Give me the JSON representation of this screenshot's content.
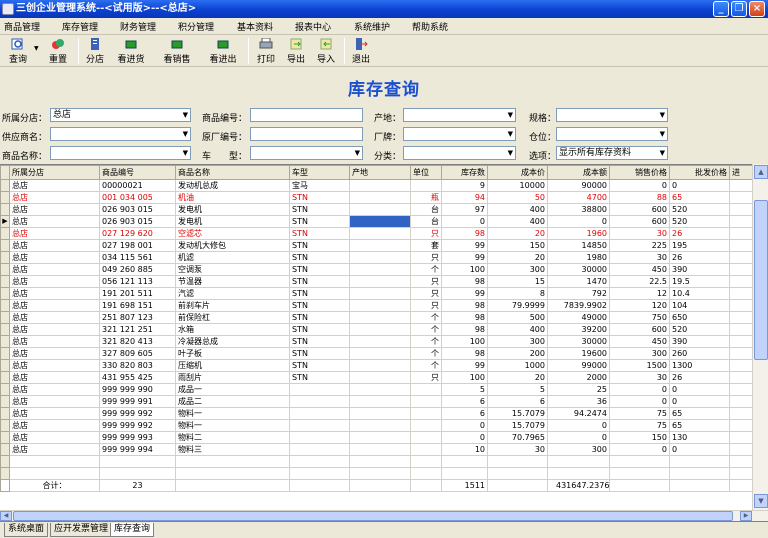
{
  "window": {
    "title": "三创企业管理系统--<试用版>--<总店>"
  },
  "menu": [
    "商品管理",
    "库存管理",
    "财务管理",
    "积分管理",
    "基本资料",
    "报表中心",
    "系统维护",
    "帮助系统"
  ],
  "toolbar": [
    {
      "label": "查询",
      "icon": "query-icon"
    },
    {
      "label": "重置",
      "icon": "reset-icon"
    },
    {
      "label": "分店",
      "icon": "branch-icon"
    },
    {
      "label": "看进货",
      "icon": "purchase-icon"
    },
    {
      "label": "看销售",
      "icon": "sales-icon"
    },
    {
      "label": "看进出",
      "icon": "inout-icon"
    },
    {
      "label": "打印",
      "icon": "print-icon"
    },
    {
      "label": "导出",
      "icon": "export-icon"
    },
    {
      "label": "导入",
      "icon": "import-icon"
    },
    {
      "label": "退出",
      "icon": "exit-icon"
    }
  ],
  "heading": "库存查询",
  "filters": {
    "branch_label": "所属分店：",
    "branch_value": "总店",
    "code_label": "商品编号：",
    "code_value": "",
    "origin_label": "产地：",
    "origin_value": "",
    "spec_label": "规格：",
    "spec_value": "",
    "supplier_label": "供应商名：",
    "supplier_value": "",
    "factory_code_label": "原厂编号：",
    "factory_code_value": "",
    "brand_label": "厂牌：",
    "brand_value": "",
    "location_label": "仓位：",
    "location_value": "",
    "name_label": "商品名称：",
    "name_value": "",
    "car_label": "车　　型：",
    "car_value": "",
    "category_label": "分类：",
    "category_value": "",
    "option_label": "选项：",
    "option_value": "显示所有库存资料"
  },
  "colors": {
    "title_blue": "#0a3fcf",
    "heading": "#1c50d0",
    "red_row": "#e00000",
    "selected": "#3163c5"
  },
  "table": {
    "columns": [
      "所属分店",
      "商品编号",
      "商品名称",
      "车型",
      "产地",
      "单位",
      "库存数",
      "成本价",
      "成本额",
      "销售价格",
      "批发价格",
      "进"
    ],
    "rows": [
      {
        "c": [
          "总店",
          "00000021",
          "发动机总成",
          "宝马",
          "",
          "",
          "9",
          "10000",
          "90000",
          "0",
          "0"
        ],
        "red": false
      },
      {
        "c": [
          "总店",
          "001 034 005",
          "机油",
          "STN",
          "",
          "瓶",
          "94",
          "50",
          "4700",
          "88",
          "65"
        ],
        "red": true
      },
      {
        "c": [
          "总店",
          "026 903 015",
          "发电机",
          "STN",
          "",
          "台",
          "97",
          "400",
          "38800",
          "600",
          "520"
        ],
        "red": false
      },
      {
        "c": [
          "总店",
          "026 903 015",
          "发电机",
          "STN",
          "",
          "台",
          "0",
          "400",
          "0",
          "600",
          "520"
        ],
        "red": false,
        "selected": true
      },
      {
        "c": [
          "总店",
          "027 129 620",
          "空滤芯",
          "STN",
          "",
          "只",
          "98",
          "20",
          "1960",
          "30",
          "26"
        ],
        "red": true
      },
      {
        "c": [
          "总店",
          "027 198 001",
          "发动机大修包",
          "STN",
          "",
          "套",
          "99",
          "150",
          "14850",
          "225",
          "195"
        ],
        "red": false
      },
      {
        "c": [
          "总店",
          "034 115 561",
          "机滤",
          "STN",
          "",
          "只",
          "99",
          "20",
          "1980",
          "30",
          "26"
        ],
        "red": false
      },
      {
        "c": [
          "总店",
          "049 260 885",
          "空调泵",
          "STN",
          "",
          "个",
          "100",
          "300",
          "30000",
          "450",
          "390"
        ],
        "red": false
      },
      {
        "c": [
          "总店",
          "056 121 113",
          "节温器",
          "STN",
          "",
          "只",
          "98",
          "15",
          "1470",
          "22.5",
          "19.5"
        ],
        "red": false
      },
      {
        "c": [
          "总店",
          "191 201 511",
          "汽滤",
          "STN",
          "",
          "只",
          "99",
          "8",
          "792",
          "12",
          "10.4"
        ],
        "red": false
      },
      {
        "c": [
          "总店",
          "191 698 151",
          "前刹车片",
          "STN",
          "",
          "只",
          "98",
          "79.9999",
          "7839.9902",
          "120",
          "104"
        ],
        "red": false
      },
      {
        "c": [
          "总店",
          "251 807 123",
          "前保险杠",
          "STN",
          "",
          "个",
          "98",
          "500",
          "49000",
          "750",
          "650"
        ],
        "red": false
      },
      {
        "c": [
          "总店",
          "321 121 251",
          "水箱",
          "STN",
          "",
          "个",
          "98",
          "400",
          "39200",
          "600",
          "520"
        ],
        "red": false
      },
      {
        "c": [
          "总店",
          "321 820 413",
          "冷凝器总成",
          "STN",
          "",
          "个",
          "100",
          "300",
          "30000",
          "450",
          "390"
        ],
        "red": false
      },
      {
        "c": [
          "总店",
          "327 809 605",
          "叶子板",
          "STN",
          "",
          "个",
          "98",
          "200",
          "19600",
          "300",
          "260"
        ],
        "red": false
      },
      {
        "c": [
          "总店",
          "330 820 803",
          "压缩机",
          "STN",
          "",
          "个",
          "99",
          "1000",
          "99000",
          "1500",
          "1300"
        ],
        "red": false
      },
      {
        "c": [
          "总店",
          "431 955 425",
          "雨刮片",
          "STN",
          "",
          "只",
          "100",
          "20",
          "2000",
          "30",
          "26"
        ],
        "red": false
      },
      {
        "c": [
          "总店",
          "999 999 990",
          "成品一",
          "",
          "",
          "",
          "5",
          "5",
          "25",
          "0",
          "0"
        ],
        "red": false
      },
      {
        "c": [
          "总店",
          "999 999 991",
          "成品二",
          "",
          "",
          "",
          "6",
          "6",
          "36",
          "0",
          "0"
        ],
        "red": false
      },
      {
        "c": [
          "总店",
          "999 999 992",
          "物料一",
          "",
          "",
          "",
          "6",
          "15.7079",
          "94.2474",
          "75",
          "65"
        ],
        "red": false
      },
      {
        "c": [
          "总店",
          "999 999 992",
          "物料一",
          "",
          "",
          "",
          "0",
          "15.7079",
          "0",
          "75",
          "65"
        ],
        "red": false
      },
      {
        "c": [
          "总店",
          "999 999 993",
          "物料二",
          "",
          "",
          "",
          "0",
          "70.7965",
          "0",
          "150",
          "130"
        ],
        "red": false
      },
      {
        "c": [
          "总店",
          "999 999 994",
          "物料三",
          "",
          "",
          "",
          "10",
          "30",
          "300",
          "0",
          "0"
        ],
        "red": false
      }
    ],
    "total": {
      "label": "合计：",
      "count": "23",
      "stock": "1511",
      "amount": "431647.2376"
    }
  },
  "tabs": [
    "系统桌面",
    "应开发票管理",
    "库存查询"
  ]
}
